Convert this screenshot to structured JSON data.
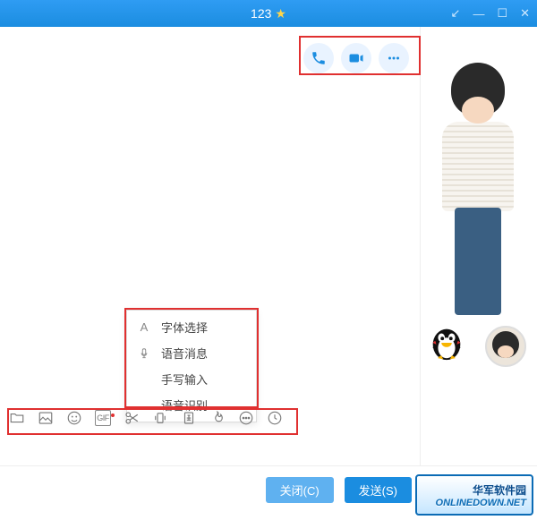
{
  "titlebar": {
    "title": "123",
    "star": "★"
  },
  "top_actions": {
    "voice_call": "voice-call",
    "video_call": "video-call",
    "more": "more"
  },
  "context_menu": {
    "items": [
      {
        "label": "字体选择",
        "icon": "A"
      },
      {
        "label": "语音消息",
        "icon": "mic"
      },
      {
        "label": "手写输入",
        "icon": ""
      },
      {
        "label": "语音识别",
        "icon": ""
      }
    ]
  },
  "toolbar": {
    "folder": "folder",
    "image": "image",
    "emoji": "emoji",
    "gif": "GIF",
    "screenshot": "screenshot",
    "shake": "shake",
    "redpacket": "redpacket",
    "music": "music",
    "more": "more",
    "history": "history"
  },
  "buttons": {
    "close": "关闭(C)",
    "send": "发送(S)"
  },
  "logo": {
    "zh": "华军软件园",
    "en": "ONLINEDOWN.NET"
  }
}
